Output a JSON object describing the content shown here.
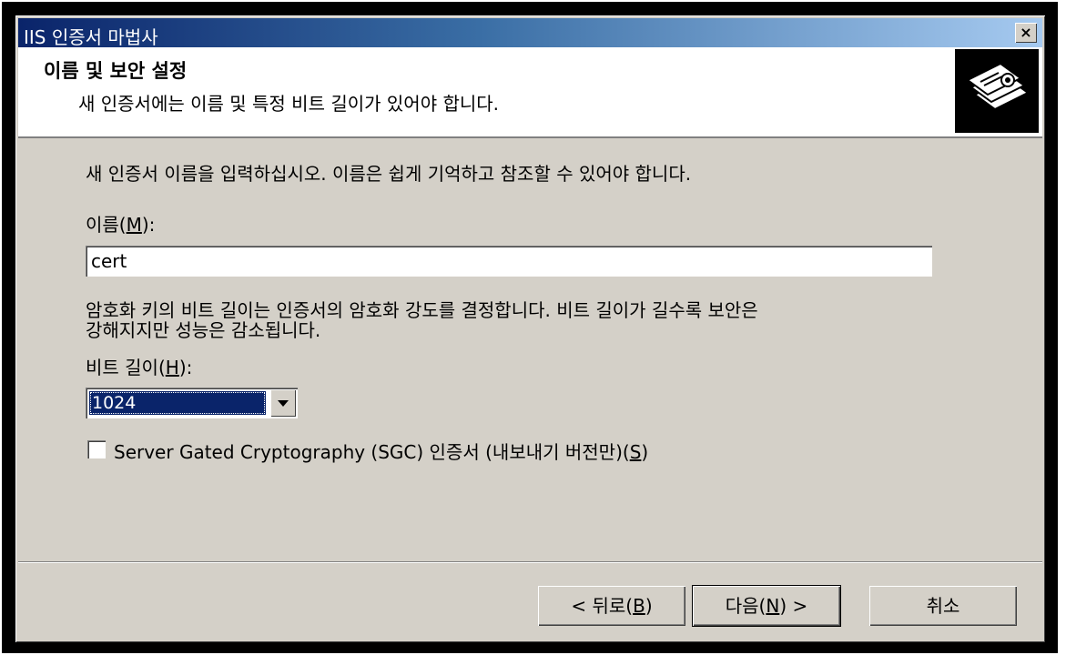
{
  "window": {
    "title": "IIS 인증서 마법사",
    "close_glyph": "×"
  },
  "header": {
    "title": "이름 및 보안 설정",
    "subtitle": "새 인증서에는 이름 및 특정 비트 길이가 있어야 합니다.",
    "icon": "certificate-wizard-icon"
  },
  "content": {
    "intro": "새 인증서 이름을 입력하십시오. 이름은 쉽게 기억하고 참조할 수 있어야 합니다.",
    "name_label_prefix": "이름(",
    "name_label_accel": "M",
    "name_label_suffix": "):",
    "name_value": "cert",
    "bitlen_desc_line1": "암호화 키의 비트 길이는 인증서의 암호화 강도를 결정합니다. 비트 길이가 길수록 보안은",
    "bitlen_desc_line2": "강해지지만 성능은 감소됩니다.",
    "bitlen_label_prefix": "비트 길이(",
    "bitlen_label_accel": "H",
    "bitlen_label_suffix": "):",
    "bitlen_value": "1024",
    "sgc_label_prefix": "Server Gated Cryptography (SGC) 인증서 (내보내기 버전만)(",
    "sgc_label_accel": "S",
    "sgc_label_suffix": ")",
    "sgc_checked": false
  },
  "buttons": {
    "back_prefix": "< 뒤로(",
    "back_accel": "B",
    "back_suffix": ")",
    "next_prefix": "다음(",
    "next_accel": "N",
    "next_suffix": ") >",
    "cancel": "취소"
  }
}
